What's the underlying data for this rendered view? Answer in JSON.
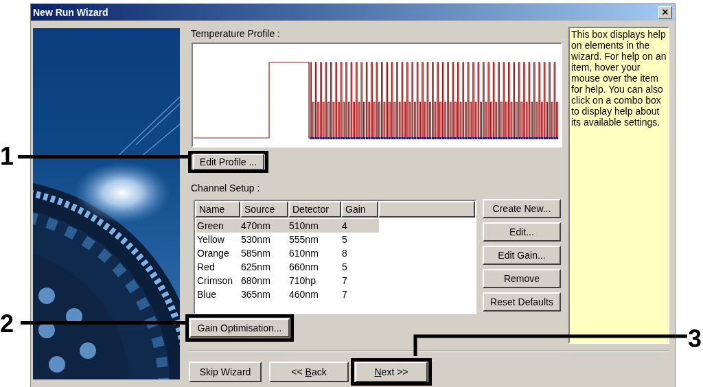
{
  "window": {
    "title": "New Run Wizard",
    "close_label": "×"
  },
  "temperature_profile": {
    "label": "Temperature Profile :"
  },
  "edit_profile_button": {
    "label": "Edit Profile ...",
    "highlighted": true
  },
  "channel_setup": {
    "label": "Channel Setup :",
    "columns": [
      "Name",
      "Source",
      "Detector",
      "Gain"
    ],
    "rows": [
      {
        "cells": [
          "Green",
          "470nm",
          "510nm",
          "4"
        ],
        "selected": true
      },
      {
        "cells": [
          "Yellow",
          "530nm",
          "555nm",
          "5"
        ],
        "selected": false
      },
      {
        "cells": [
          "Orange",
          "585nm",
          "610nm",
          "8"
        ],
        "selected": false
      },
      {
        "cells": [
          "Red",
          "625nm",
          "660nm",
          "5"
        ],
        "selected": false
      },
      {
        "cells": [
          "Crimson",
          "680nm",
          "710hp",
          "7"
        ],
        "selected": false
      },
      {
        "cells": [
          "Blue",
          "365nm",
          "460nm",
          "7"
        ],
        "selected": false
      }
    ],
    "buttons": [
      "Create New...",
      "Edit...",
      "Edit Gain...",
      "Remove",
      "Reset Defaults"
    ]
  },
  "gain_optimisation_button": {
    "label": "Gain Optimisation...",
    "highlighted": true
  },
  "help_box": {
    "text": "This box displays help on elements in the wizard. For help on an item, hover your mouse over the item for help. You can also click on a combo box to display help about its available settings."
  },
  "footer_buttons": [
    {
      "label": "Skip Wizard",
      "highlighted": false
    },
    {
      "label_before": "<< ",
      "access_key": "B",
      "label_after": "ack",
      "highlighted": false
    },
    {
      "access_key": "N",
      "label_after": "ext >>",
      "highlighted": true
    }
  ],
  "callouts": [
    {
      "label": "1"
    },
    {
      "label": "2"
    },
    {
      "label": "3"
    }
  ]
}
